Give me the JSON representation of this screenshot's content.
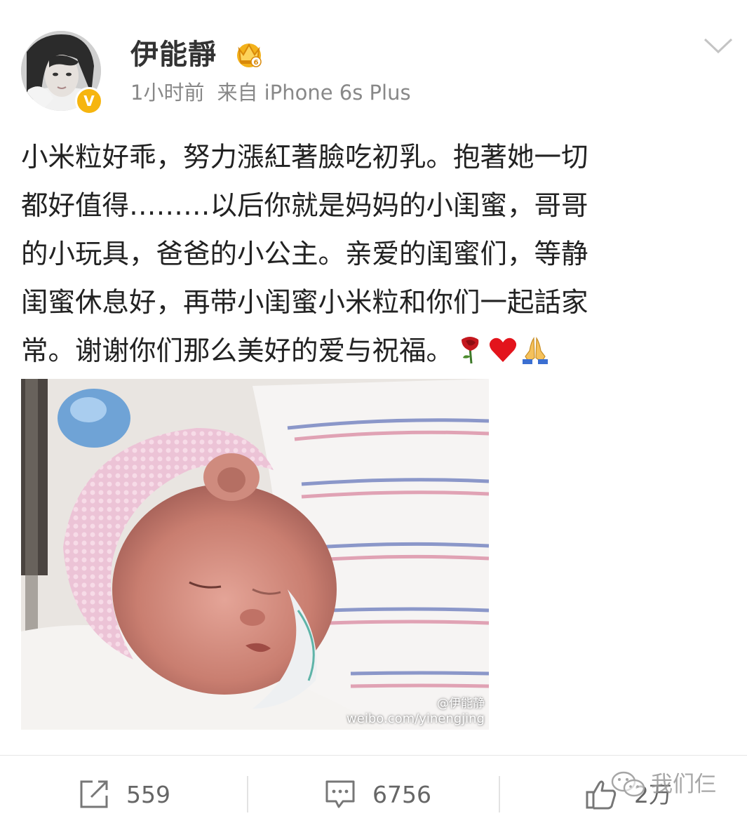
{
  "post": {
    "username": "伊能靜",
    "time": "1小时前",
    "source": "来自 iPhone 6s Plus",
    "verified_mark": "V",
    "text_lines": [
      "小米粒好乖，努力漲紅著臉吃初乳。抱著她一切",
      "都好值得………以后你就是妈妈的小闺蜜，哥哥",
      "的小玩具，爸爸的小公主。亲爱的闺蜜们，等静",
      "闺蜜休息好，再带小闺蜜小米粒和你们一起話家",
      "常。谢谢你们那么美好的爱与祝福。"
    ],
    "emojis": [
      "rose-icon",
      "heart-icon",
      "praying-hands-icon"
    ]
  },
  "photo": {
    "watermark_handle": "@伊能静",
    "watermark_url": "weibo.com/yinengjing"
  },
  "actions": {
    "repost_count": "559",
    "comment_count": "6756",
    "like_count": "2万"
  },
  "overlay": {
    "wechat_text": "我们仨"
  },
  "colors": {
    "text_primary": "#222222",
    "text_secondary": "#888888",
    "verified": "#f6b50f",
    "vip_crown": "#f3b21b"
  }
}
